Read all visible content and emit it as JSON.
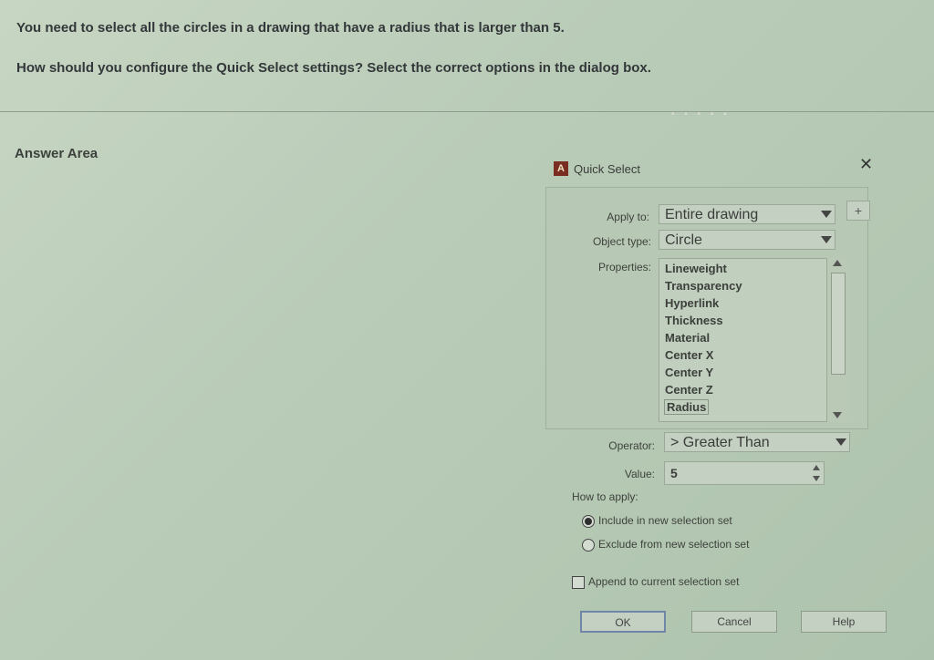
{
  "question": {
    "line1": "You need to select all the circles in a drawing that have a radius that is larger than 5.",
    "line2": "How should you configure the Quick Select settings? Select the correct options in the dialog box."
  },
  "answer_area_label": "Answer Area",
  "dialog": {
    "title": "Quick Select",
    "close_glyph": "✕",
    "apply_to": {
      "label": "Apply to:",
      "value": "Entire drawing"
    },
    "object_type": {
      "label": "Object type:",
      "value": "Circle"
    },
    "properties": {
      "label": "Properties:",
      "items": [
        "Lineweight",
        "Transparency",
        "Hyperlink",
        "Thickness",
        "Material",
        "Center X",
        "Center Y",
        "Center Z",
        "Radius"
      ],
      "selected": "Radius"
    },
    "operator": {
      "label": "Operator:",
      "value": "> Greater Than"
    },
    "value_field": {
      "label": "Value:",
      "value": "5"
    },
    "how_to_apply": {
      "label": "How to apply:",
      "options": [
        "Include in new selection set",
        "Exclude from new selection set"
      ],
      "selected_index": 0
    },
    "append_checkbox": {
      "label": "Append to current selection set",
      "checked": false
    },
    "buttons": {
      "ok": "OK",
      "cancel": "Cancel",
      "help": "Help"
    },
    "quick_select_icon": "+"
  }
}
